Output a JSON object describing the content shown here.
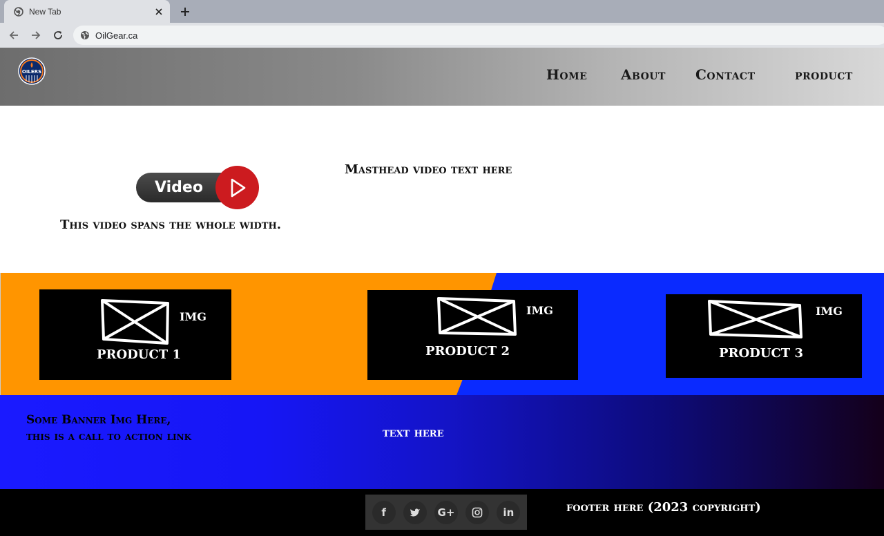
{
  "browser": {
    "tab_title": "New Tab",
    "url": "OilGear.ca",
    "icons": [
      "chrome-icon",
      "close-icon",
      "plus-icon",
      "back-icon",
      "forward-icon",
      "reload-icon",
      "globe-icon"
    ]
  },
  "header": {
    "logo_alt": "OILERS",
    "nav": [
      {
        "label": "Home"
      },
      {
        "label": "About"
      },
      {
        "label": "Contact"
      },
      {
        "label": "product"
      }
    ]
  },
  "masthead": {
    "video_button_label": "Video",
    "caption": "This video spans the whole width.",
    "text": "Masthead video text here"
  },
  "products": {
    "img_label": "IMG",
    "items": [
      {
        "name": "PRODUCT 1"
      },
      {
        "name": "PRODUCT 2"
      },
      {
        "name": "PRODUCT 3"
      }
    ],
    "colors": {
      "left": "#ff9500",
      "right": "#0a2aff",
      "card": "#000000"
    }
  },
  "banner": {
    "cta_line1": "Some Banner Img Here,",
    "cta_line2": "this is a call to action link",
    "text": "text here"
  },
  "footer": {
    "social": [
      {
        "icon": "facebook-icon",
        "glyph": "f"
      },
      {
        "icon": "twitter-icon",
        "glyph": "t"
      },
      {
        "icon": "google-plus-icon",
        "glyph": "G+"
      },
      {
        "icon": "instagram-icon",
        "glyph": "◎"
      },
      {
        "icon": "linkedin-icon",
        "glyph": "in"
      }
    ],
    "text": "footer here (2023 copyright)"
  }
}
